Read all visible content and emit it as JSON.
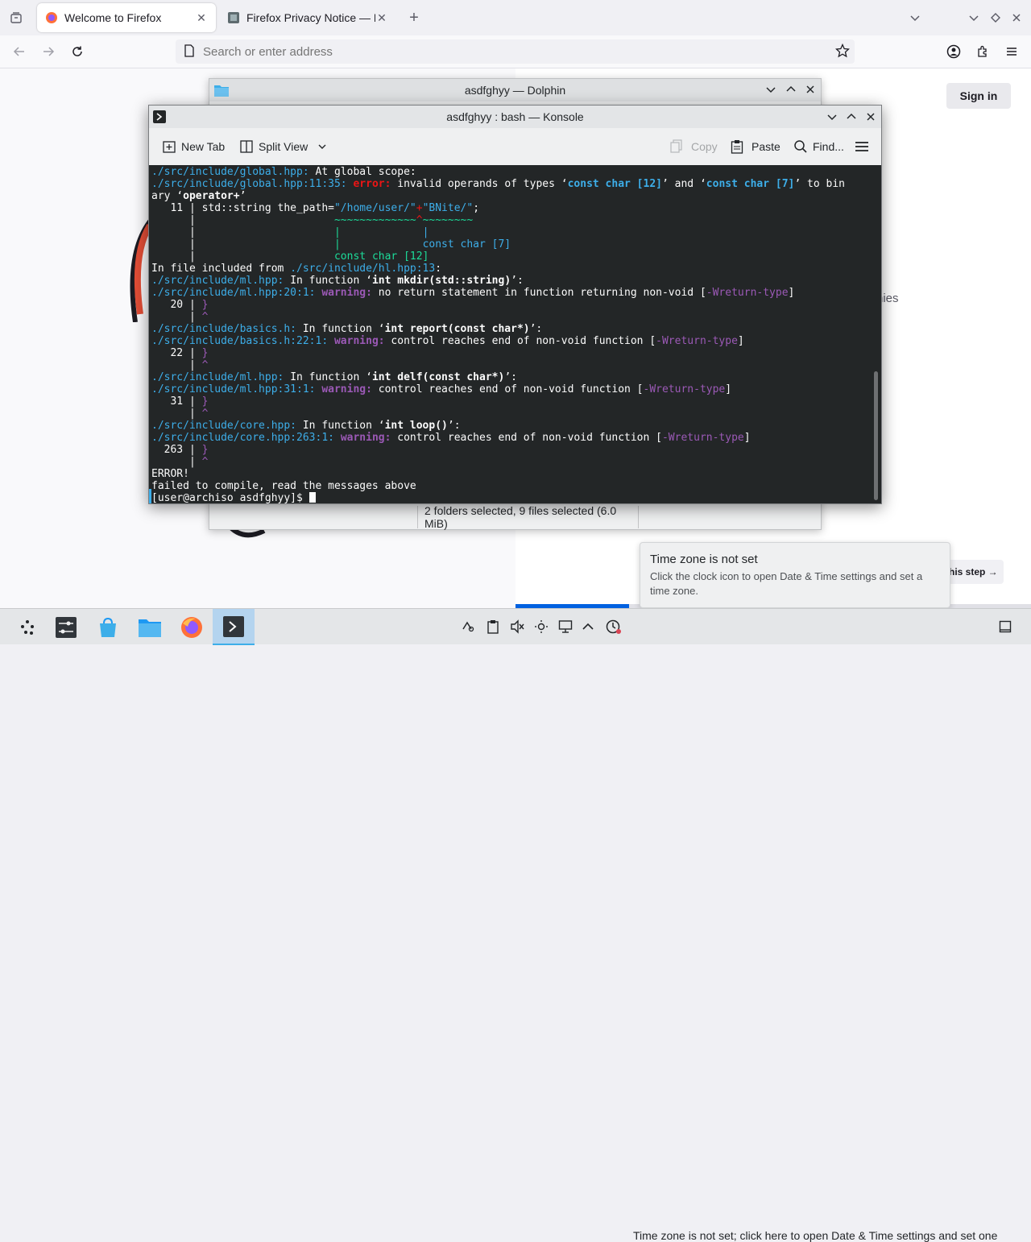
{
  "firefox": {
    "tabs": [
      {
        "label": "Welcome to Firefox",
        "active": true
      },
      {
        "label": "Firefox Privacy Notice — M",
        "active": false
      }
    ],
    "url_placeholder": "Search or enter address",
    "sign_in_label": "Sign in",
    "partial_text": "nies",
    "skip_label": "Skip this step →",
    "onboarding_progress": 0.22
  },
  "dolphin": {
    "title": "asdfghyy — Dolphin",
    "status": "2 folders selected, 9 files selected (6.0 MiB)"
  },
  "konsole": {
    "title": "asdfghyy : bash — Konsole",
    "toolbar": {
      "new_tab": "New Tab",
      "split_view": "Split View",
      "copy": "Copy",
      "paste": "Paste",
      "find": "Find..."
    },
    "prompt": "[user@archiso asdfghyy]$ "
  },
  "notification": {
    "title": "Time zone is not set",
    "body": "Click the clock icon to open Date & Time settings and set a time zone."
  },
  "taskbar": {
    "tray_text": "Time zone is not set; click here to open Date & Time settings and set one",
    "icons": [
      "app-launcher-icon",
      "system-settings-icon",
      "discover-icon",
      "dolphin-icon",
      "firefox-icon",
      "konsole-icon"
    ]
  },
  "colors": {
    "accent": "#3daee9",
    "terminal_bg": "#232627",
    "error": "#ed1515",
    "warning": "#9b59b6"
  }
}
